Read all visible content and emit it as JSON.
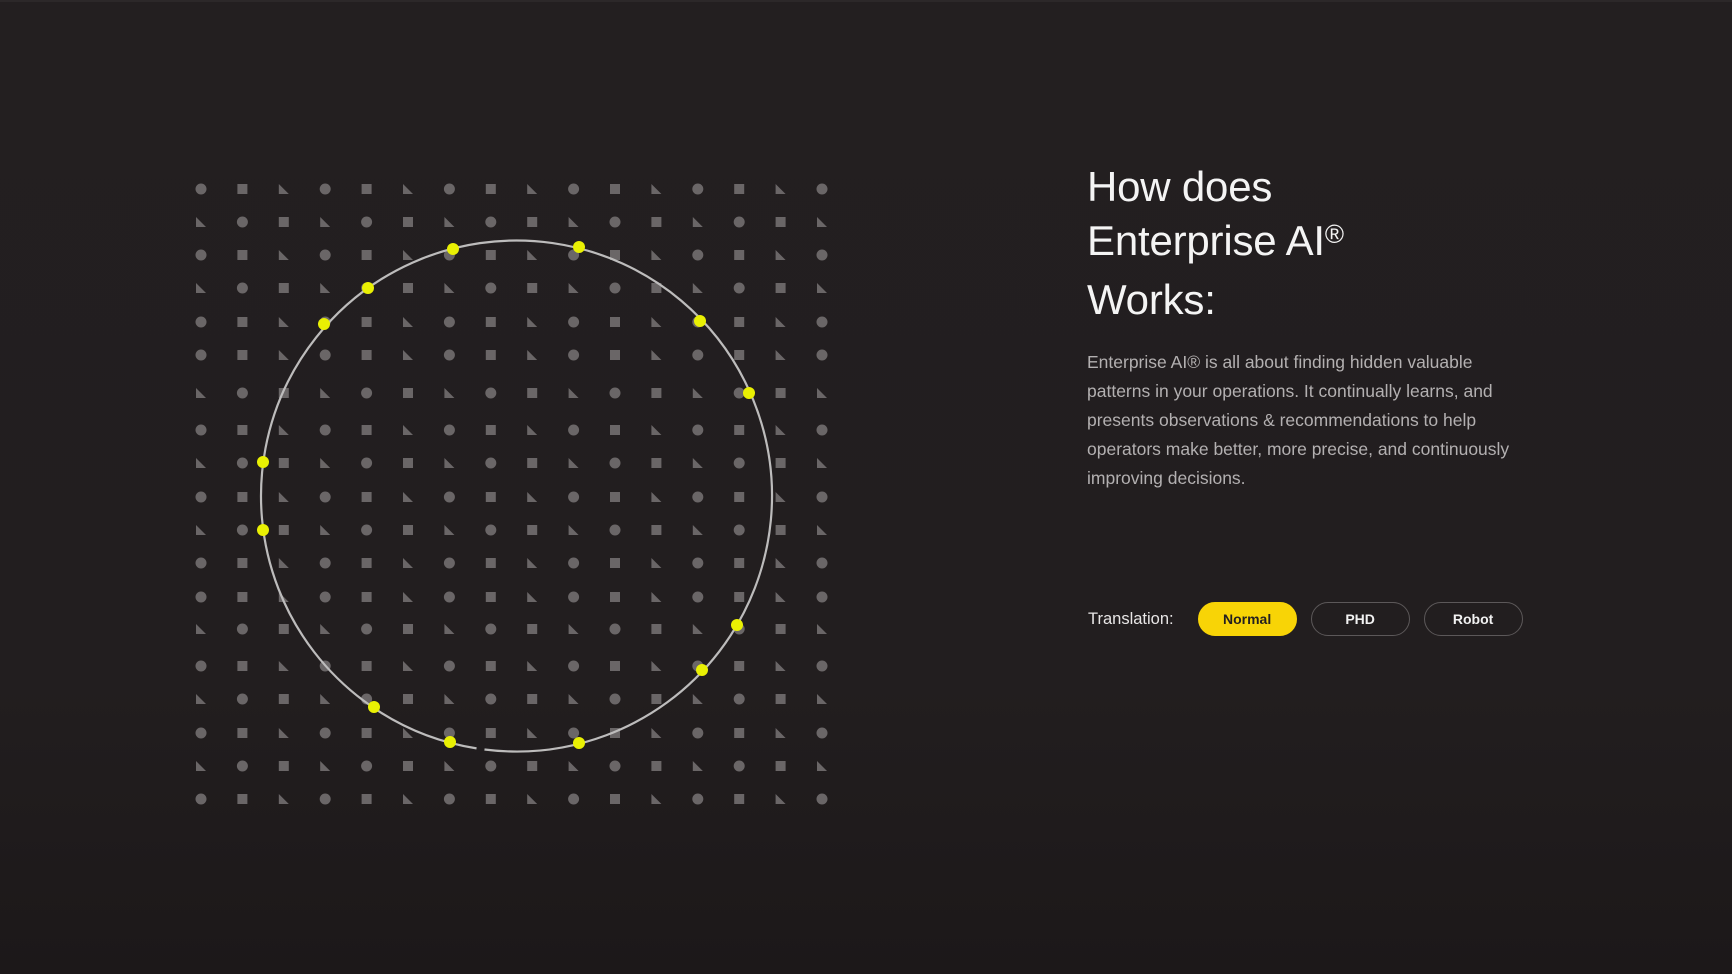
{
  "heading": {
    "line1": "How does",
    "line2": "Enterprise AI",
    "registered_mark": "®",
    "line3": "Works:"
  },
  "description": "Enterprise AI® is all about finding hidden valuable patterns in your operations. It continually learns, and presents observations & recommendations to help operators make better, more precise, and continuously improving decisions.",
  "translation": {
    "label": "Translation:",
    "options": [
      {
        "label": "Normal",
        "selected": true
      },
      {
        "label": "PHD",
        "selected": false
      },
      {
        "label": "Robot",
        "selected": false
      }
    ]
  },
  "visual": {
    "description": "Grid of gray shapes (circles, squares, triangles) with a circular ring marked by yellow nodes",
    "shape_types": [
      "circle",
      "square",
      "triangle"
    ],
    "grid_columns": 16,
    "grid_rows": 19,
    "ring_node_count": 14,
    "colors": {
      "background": "#231f20",
      "grid_shape": "#6a6667",
      "ring": "#bdbcbc",
      "ring_node": "#e9f003",
      "accent": "#f8d406"
    }
  }
}
